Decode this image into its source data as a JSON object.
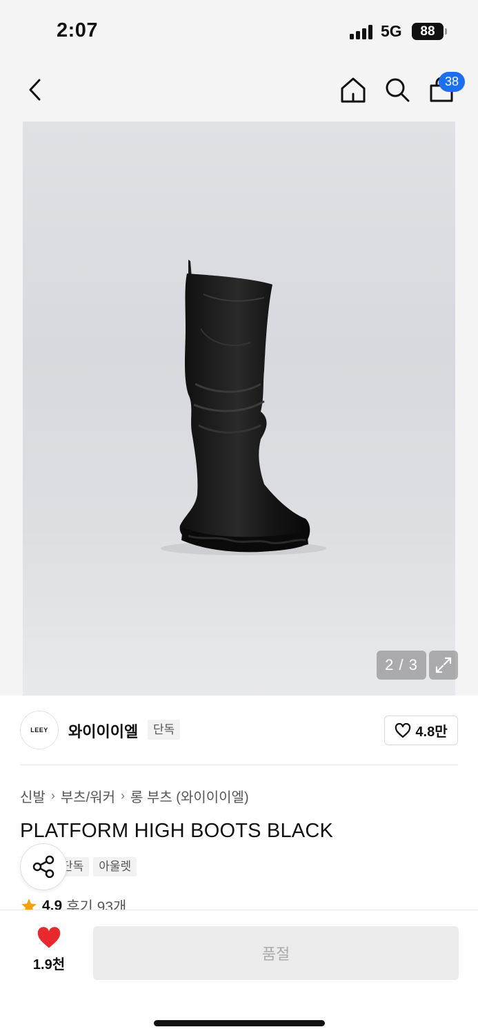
{
  "status_bar": {
    "time": "2:07",
    "network": "5G",
    "battery": "88"
  },
  "nav": {
    "cart_count": "38",
    "icons": [
      "chevron-left-icon",
      "home-icon",
      "search-icon",
      "shopping-bag-icon"
    ]
  },
  "gallery": {
    "current": "2",
    "separator": "/",
    "total": "3",
    "expand_icon": "expand-icon"
  },
  "brand": {
    "logo_text": "LEEY",
    "name": "와이이이엘",
    "tag": "단독",
    "like_count": "4.8만"
  },
  "product": {
    "breadcrumb": [
      "신발",
      "부츠/워커",
      "롱 부츠 (와이이이엘)"
    ],
    "title": "PLATFORM HIGH BOOTS BLACK",
    "tags": [
      "단독",
      "아울렛"
    ],
    "rating": "4.9",
    "reviews": "후기 93개"
  },
  "bottom": {
    "favorite_count": "1.9천",
    "soldout_label": "품절"
  },
  "colors": {
    "accent_blue": "#1d6ff2",
    "heart_red": "#e8282d",
    "star_orange": "#f5a20a"
  }
}
